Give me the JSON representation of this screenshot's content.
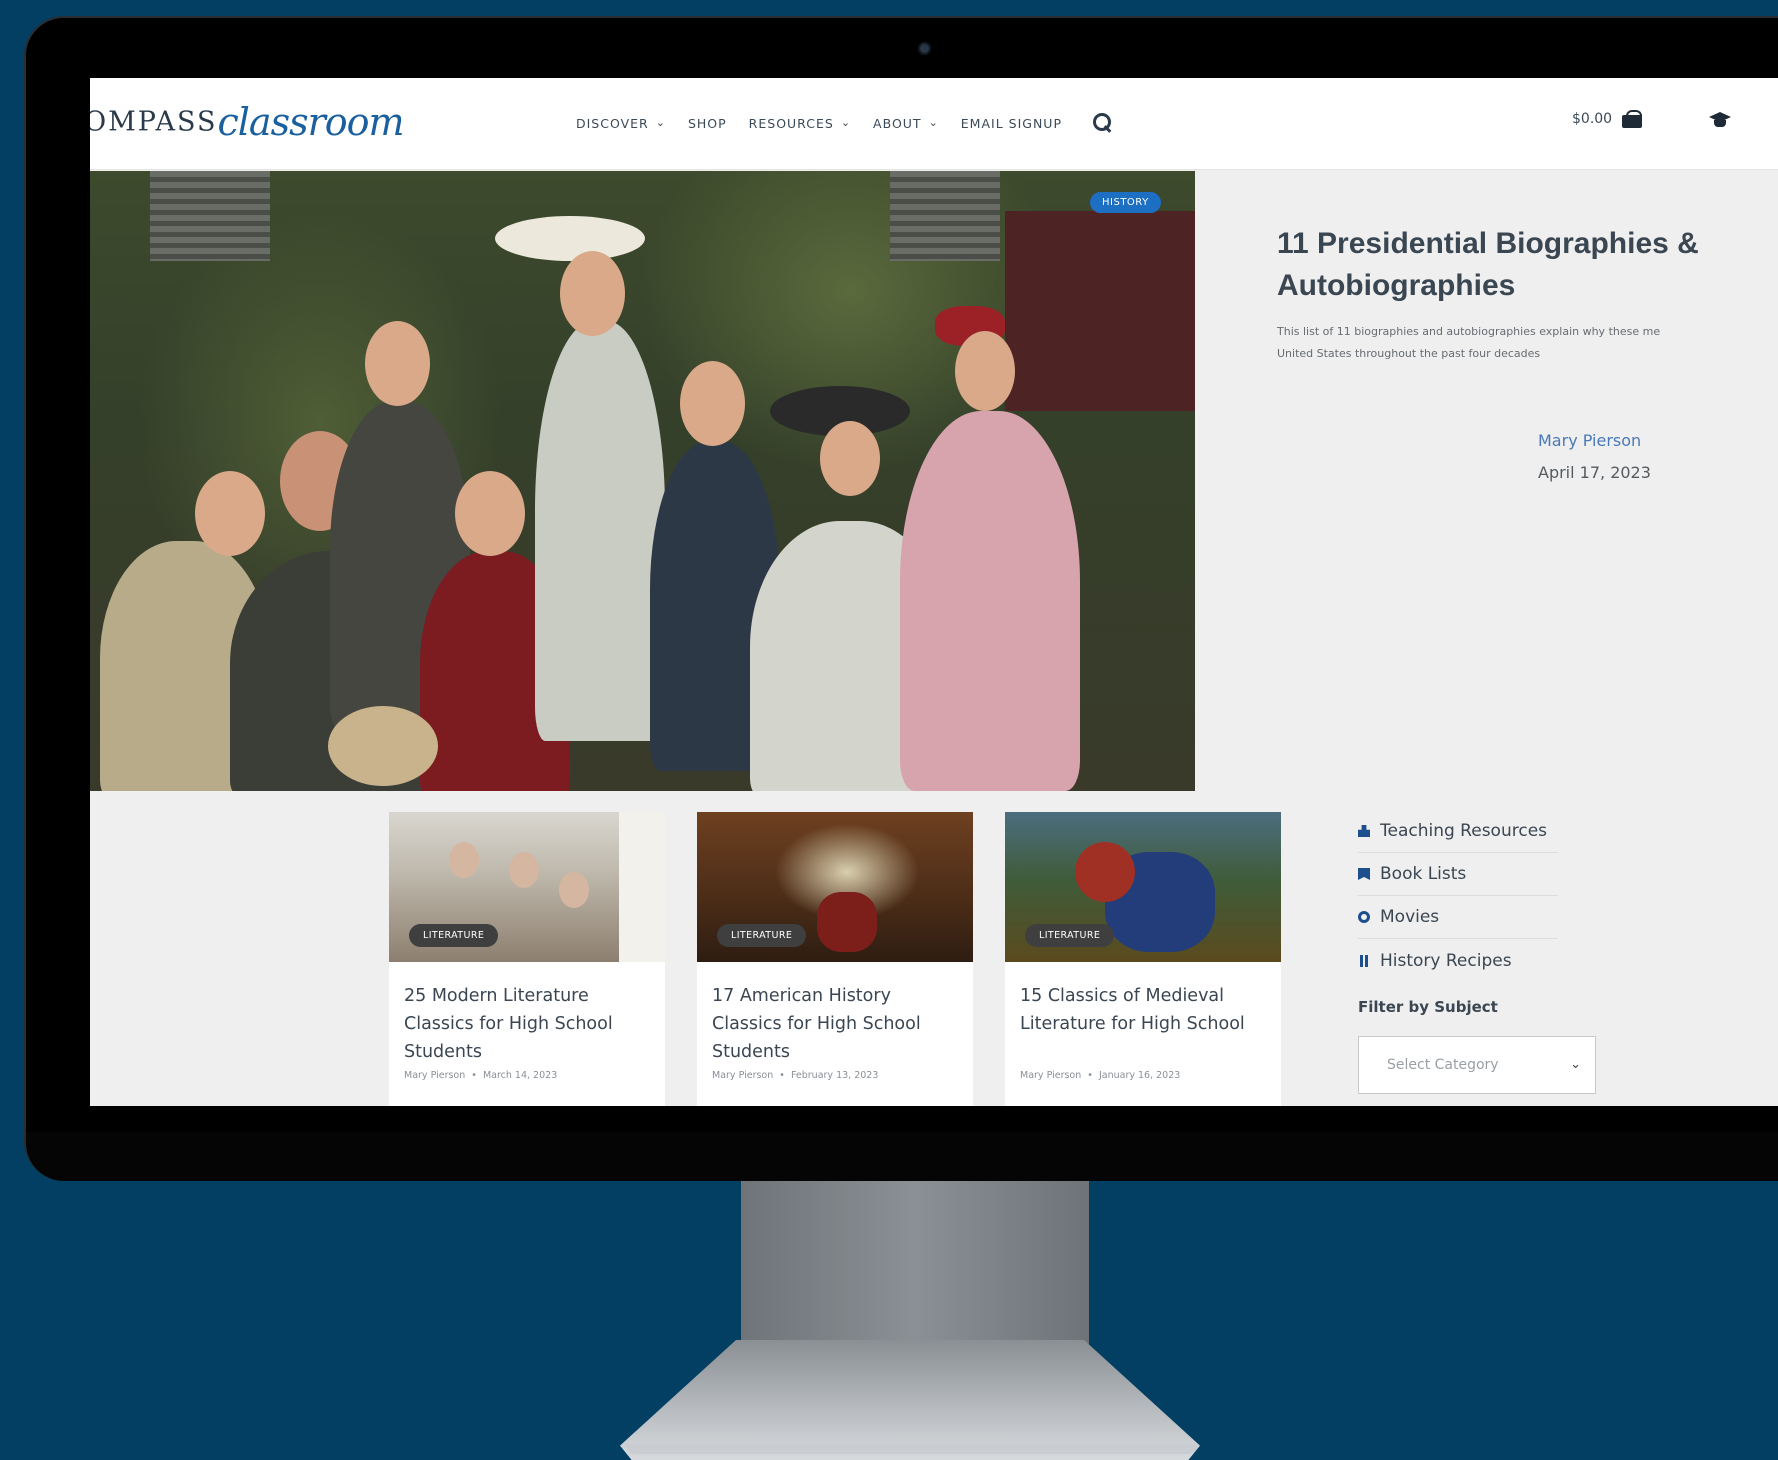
{
  "header": {
    "logo": {
      "part1": "OMPASS",
      "part2": "classroom"
    },
    "nav": [
      {
        "label": "DISCOVER",
        "has_dropdown": true
      },
      {
        "label": "SHOP",
        "has_dropdown": false
      },
      {
        "label": "RESOURCES",
        "has_dropdown": true
      },
      {
        "label": "ABOUT",
        "has_dropdown": true
      },
      {
        "label": "EMAIL SIGNUP",
        "has_dropdown": false
      }
    ],
    "search_icon": "search-icon",
    "cart_total": "$0.00",
    "cart_icon": "cart-icon",
    "account_icon": "graduation-cap-icon"
  },
  "hero": {
    "category": "HISTORY",
    "title": "11 Presidential Biographies & Autobiographies",
    "excerpt_line1": "This list of 11 biographies and autobiographies explain why these me",
    "excerpt_line2": "United States throughout the past four decades",
    "author": "Mary Pierson",
    "date": "April 17, 2023"
  },
  "cards": [
    {
      "category": "LITERATURE",
      "title": "25 Modern Literature Classics for High School Students",
      "author": "Mary Pierson",
      "date": "March 14, 2023"
    },
    {
      "category": "LITERATURE",
      "title": "17 American History Classics for High School Students",
      "author": "Mary Pierson",
      "date": "February 13, 2023"
    },
    {
      "category": "LITERATURE",
      "title": "15 Classics of Medieval Literature for High School",
      "author": "Mary Pierson",
      "date": "January 16, 2023"
    }
  ],
  "sidebar": {
    "links": [
      {
        "label": "Teaching Resources",
        "icon": "teaching-icon"
      },
      {
        "label": "Book Lists",
        "icon": "bookmark-icon"
      },
      {
        "label": "Movies",
        "icon": "movie-icon"
      },
      {
        "label": "History Recipes",
        "icon": "utensils-icon"
      }
    ],
    "filter_label": "Filter by Subject",
    "filter_placeholder": "Select Category"
  },
  "colors": {
    "page_background": "#023f63",
    "accent_blue": "#1d6fc4",
    "text_dark": "#3a4652",
    "link_blue": "#4a79b8"
  }
}
